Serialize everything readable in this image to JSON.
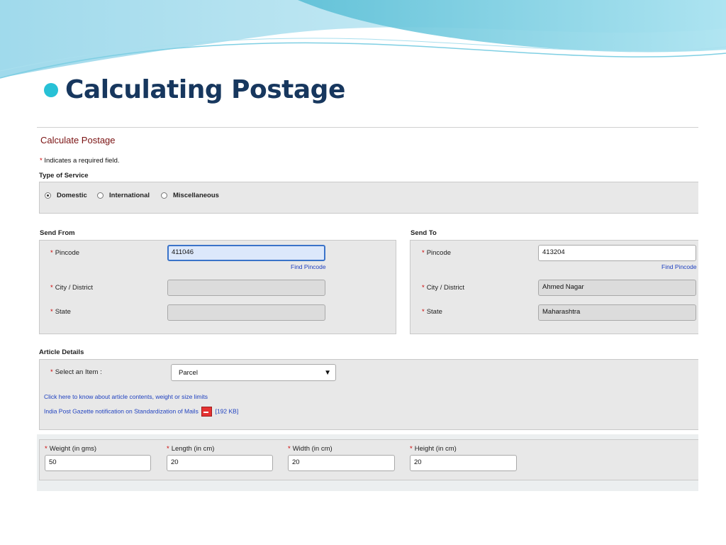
{
  "slide": {
    "title": "Calculating Postage"
  },
  "form": {
    "title": "Calculate Postage",
    "required_note": "Indicates a required field.",
    "required_marker": "*",
    "service": {
      "label": "Type of Service",
      "options": [
        {
          "label": "Domestic",
          "selected": true
        },
        {
          "label": "International",
          "selected": false
        },
        {
          "label": "Miscellaneous",
          "selected": false
        }
      ]
    },
    "send_from": {
      "label": "Send From",
      "pincode_label": "Pincode",
      "pincode_value": "411046",
      "find_pincode": "Find Pincode",
      "city_label": "City / District",
      "city_value": "",
      "state_label": "State",
      "state_value": ""
    },
    "send_to": {
      "label": "Send To",
      "pincode_label": "Pincode",
      "pincode_value": "413204",
      "find_pincode": "Find Pincode",
      "city_label": "City / District",
      "city_value": "Ahmed Nagar",
      "state_label": "State",
      "state_value": "Maharashtra"
    },
    "article": {
      "label": "Article Details",
      "item_label": "Select an Item :",
      "item_value": "Parcel",
      "link_limits": "Click here to know about article contents, weight or size limits",
      "link_gazette": "India Post Gazette notification on Standardization of Mails",
      "gazette_size": "[192 KB]"
    },
    "dimensions": {
      "weight_label": "Weight (in gms)",
      "weight_value": "50",
      "length_label": "Length (in cm)",
      "length_value": "20",
      "width_label": "Width (in cm)",
      "width_value": "20",
      "height_label": "Height (in cm)",
      "height_value": "20"
    }
  },
  "colors": {
    "title_text": "#17375e",
    "bullet": "#27c1d6",
    "form_title": "#7a1212",
    "required_star": "#cc0000",
    "link": "#1d3fbf",
    "focused_input_bg": "#dce8fb"
  },
  "icons": [
    "bullet-dot",
    "radio-icon",
    "dropdown-arrow-icon",
    "pdf-icon"
  ]
}
